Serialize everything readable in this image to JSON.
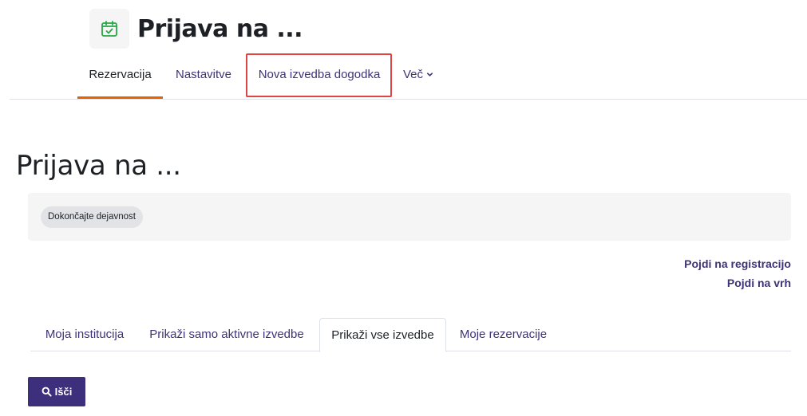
{
  "header": {
    "title": "Prijava na ...",
    "icon": "calendar-check-icon",
    "icon_color": "#28a745"
  },
  "secondary_nav": {
    "items": [
      {
        "label": "Rezervacija",
        "active": true
      },
      {
        "label": "Nastavitve",
        "active": false
      },
      {
        "label": "Nova izvedba dogodka",
        "active": false,
        "highlighted": true
      },
      {
        "label": "Več",
        "active": false,
        "dropdown": true
      }
    ],
    "active_color": "#e66100",
    "highlight_color": "#e04444"
  },
  "page": {
    "title": "Prijava na ..."
  },
  "completion": {
    "badge_label": "Dokončajte dejavnost"
  },
  "jump_links": {
    "registration": "Pojdi na registracijo",
    "top": "Pojdi na vrh"
  },
  "tabs": {
    "items": [
      {
        "label": "Moja institucija",
        "active": false
      },
      {
        "label": "Prikaži samo aktivne izvedbe",
        "active": false
      },
      {
        "label": "Prikaži vse izvedbe",
        "active": true
      },
      {
        "label": "Moje rezervacije",
        "active": false
      }
    ]
  },
  "search": {
    "button_label": "Išči",
    "icon": "search-icon",
    "button_color": "#3d2f7c"
  }
}
